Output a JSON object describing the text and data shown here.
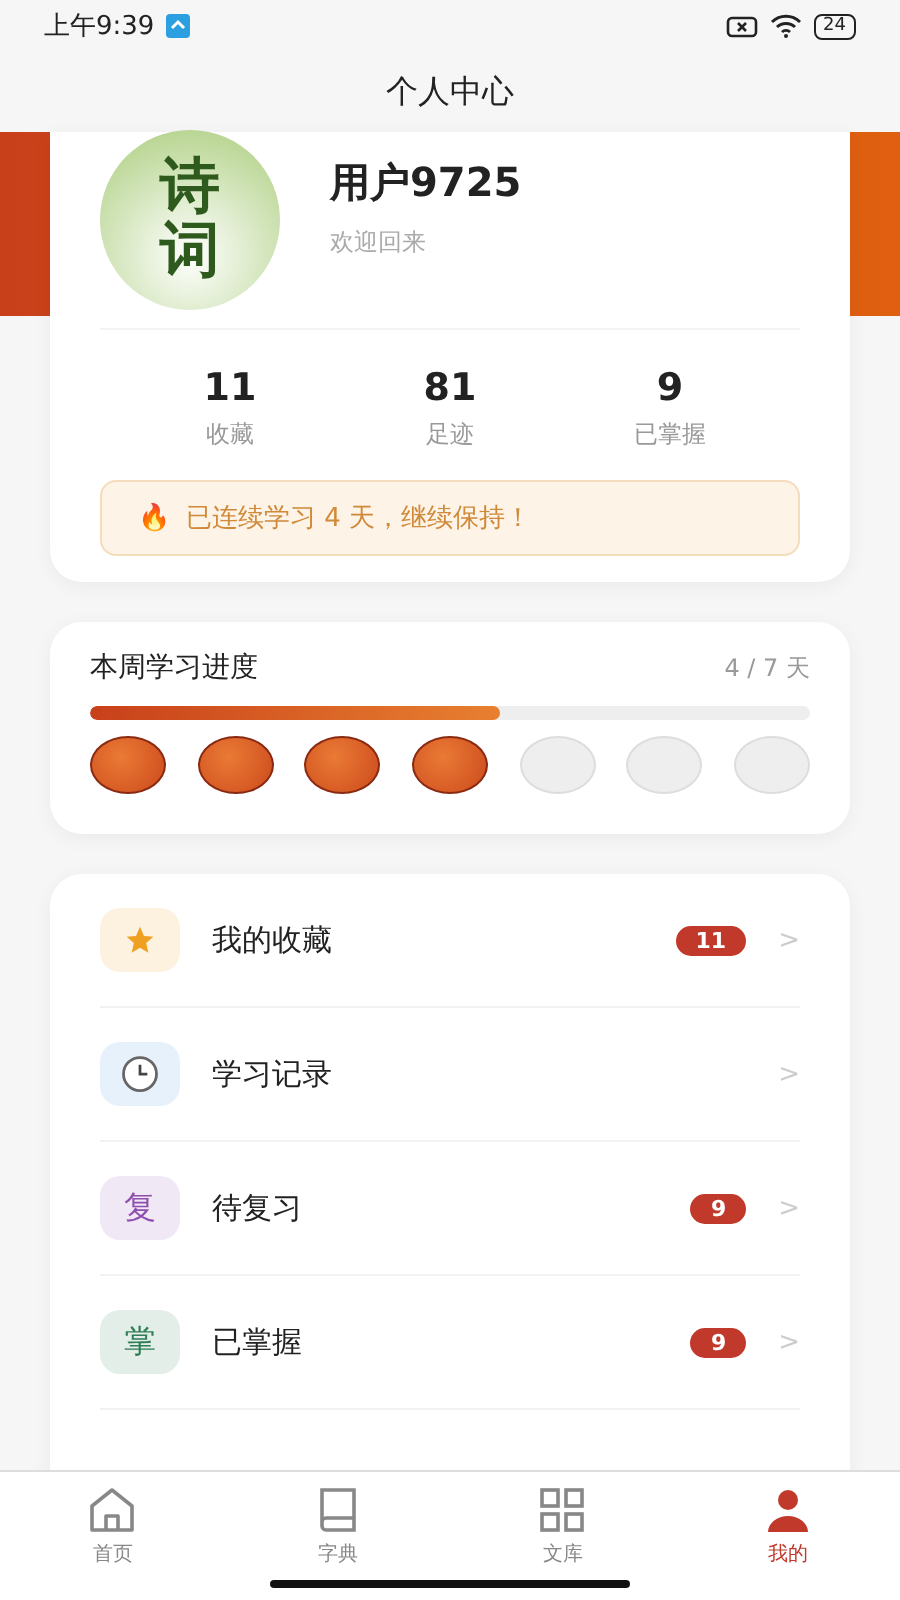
{
  "status_bar": {
    "time": "上午9:39",
    "battery": "24"
  },
  "header": {
    "title": "个人中心"
  },
  "profile": {
    "avatar_text": "诗词",
    "name": "用户9725",
    "subtitle": "欢迎回来"
  },
  "stats": [
    {
      "value": "11",
      "label": "收藏"
    },
    {
      "value": "81",
      "label": "足迹"
    },
    {
      "value": "9",
      "label": "已掌握"
    }
  ],
  "streak": {
    "icon": "🔥",
    "text": "已连续学习 4 天，继续保持！"
  },
  "weekly_progress": {
    "title": "本周学习进度",
    "reading": "4 / 7 天",
    "level": 0.57,
    "days": [
      {
        "done": true
      },
      {
        "done": true
      },
      {
        "done": true
      },
      {
        "done": true
      },
      {
        "done": false
      },
      {
        "done": false
      },
      {
        "done": false
      }
    ]
  },
  "menu": [
    {
      "kind": "star",
      "label": "我的收藏",
      "badge": "11",
      "chevron": ">"
    },
    {
      "kind": "clock",
      "label": "学习记录",
      "chevron": ">"
    },
    {
      "kind": "char",
      "icon_text": "复",
      "color": "#8e4fb0",
      "label": "待复习",
      "badge": "9",
      "chevron": ">"
    },
    {
      "kind": "char",
      "icon_text": "掌",
      "color": "#2f7d55",
      "label": "已掌握",
      "badge": "9",
      "chevron": ">"
    }
  ],
  "tab_bar": [
    {
      "kind": "home",
      "label": "首页",
      "selected": false
    },
    {
      "kind": "book",
      "label": "字典",
      "selected": false
    },
    {
      "kind": "grid",
      "label": "文库",
      "selected": false
    },
    {
      "kind": "person",
      "label": "我的",
      "selected": true
    }
  ]
}
